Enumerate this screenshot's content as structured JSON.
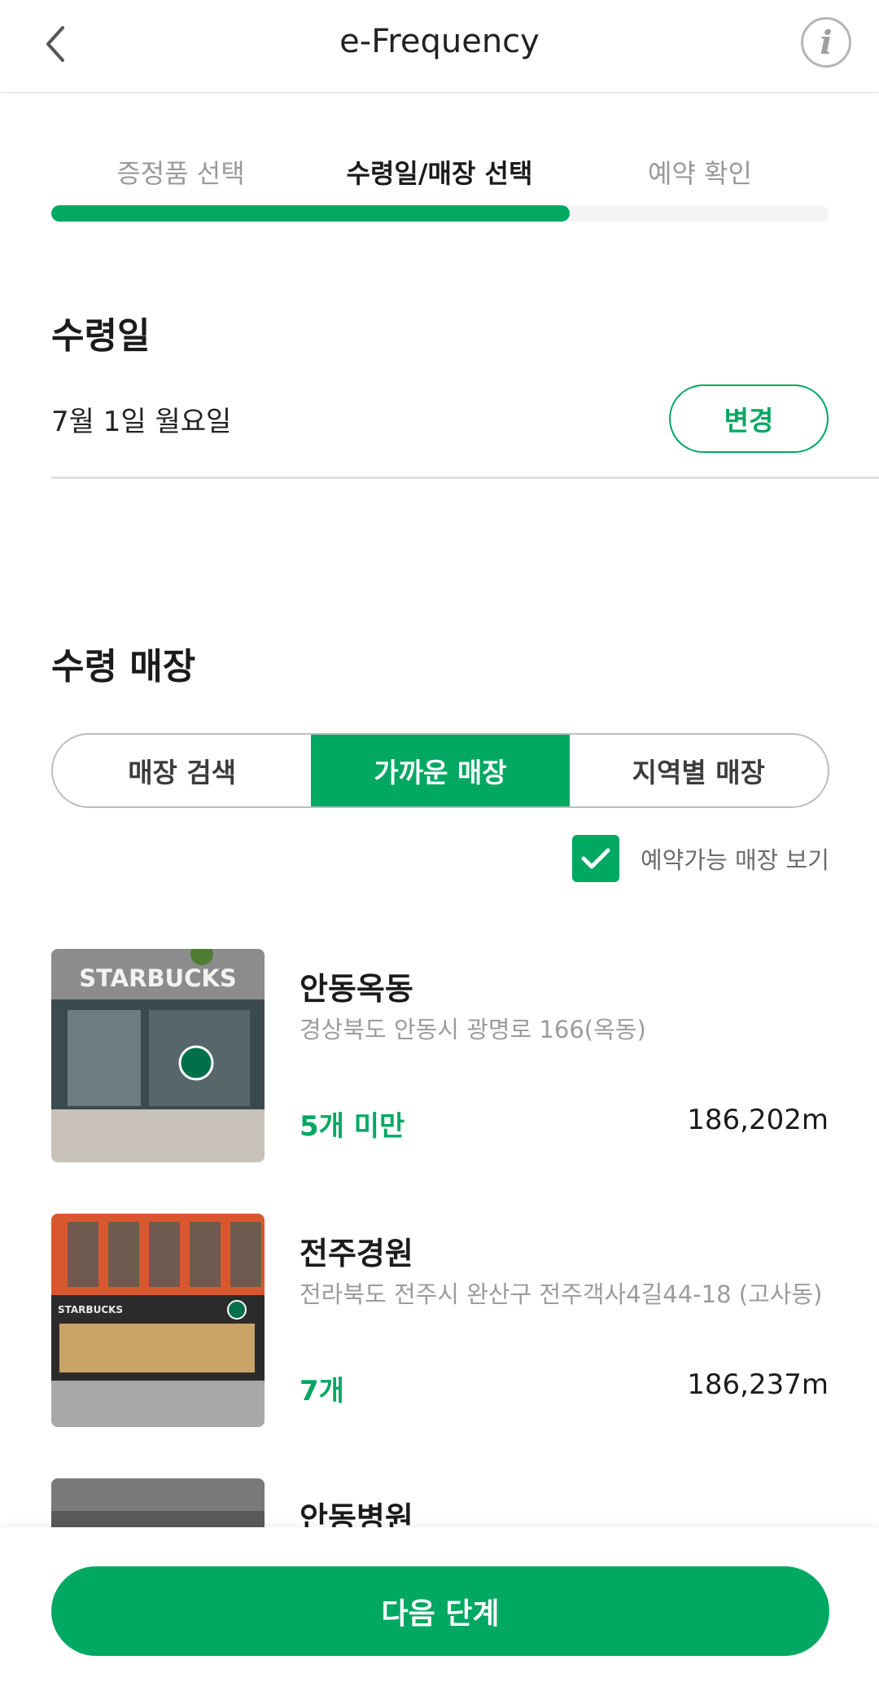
{
  "header": {
    "title": "e-Frequency"
  },
  "steps": [
    {
      "label": "증정품 선택",
      "active": false
    },
    {
      "label": "수령일/매장 선택",
      "active": true
    },
    {
      "label": "예약 확인",
      "active": false
    }
  ],
  "progress_fraction": 0.667,
  "pickup_date": {
    "section_title": "수령일",
    "value": "7월 1일 월요일",
    "change_label": "변경"
  },
  "pickup_store": {
    "section_title": "수령 매장",
    "tabs": [
      "매장 검색",
      "가까운 매장",
      "지역별 매장"
    ],
    "active_tab": 1,
    "filter_label": "예약가능 매장 보기",
    "filter_checked": true
  },
  "stores": [
    {
      "name": "안동옥동",
      "address": "경상북도 안동시 광명로 166(옥동)",
      "stock": "5개 미만",
      "distance": "186,202m",
      "thumb_text": "STARBUCKS"
    },
    {
      "name": "전주경원",
      "address": "전라북도 전주시 완산구 전주객사4길44-18 (고사동)",
      "stock": "7개",
      "distance": "186,237m",
      "thumb_text": "STARBUCKS"
    },
    {
      "name": "안동병원",
      "address": "",
      "stock": "",
      "distance": "",
      "thumb_text": ""
    }
  ],
  "footer": {
    "next_label": "다음 단계"
  },
  "colors": {
    "accent": "#00a862",
    "muted": "#9a9a9a",
    "text": "#1b1b1b"
  },
  "icons": {
    "back": "chevron-left-icon",
    "info": "info-icon",
    "check": "checkmark-icon"
  }
}
